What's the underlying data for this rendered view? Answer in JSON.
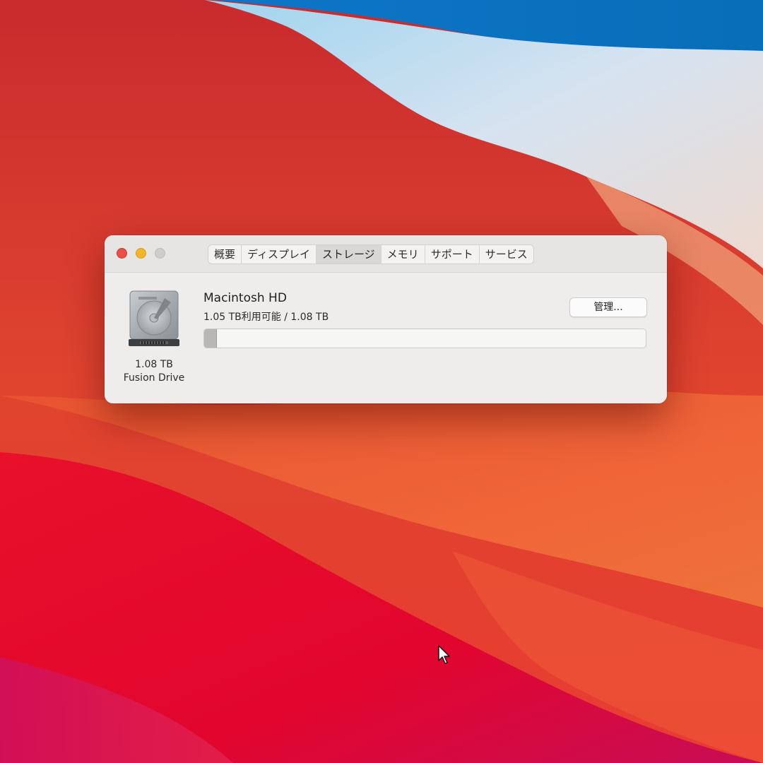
{
  "window": {
    "tabs": [
      {
        "label": "概要"
      },
      {
        "label": "ディスプレイ"
      },
      {
        "label": "ストレージ"
      },
      {
        "label": "メモリ"
      },
      {
        "label": "サポート"
      },
      {
        "label": "サービス"
      }
    ],
    "active_tab": "ストレージ"
  },
  "disk": {
    "icon": "hard-drive-icon",
    "size": "1.08 TB",
    "type": "Fusion Drive"
  },
  "volume": {
    "name": "Macintosh HD",
    "usage_text": "1.05 TB利用可能 / 1.08 TB",
    "used_fraction": 0.028
  },
  "manage_button": {
    "label": "管理..."
  },
  "colors": {
    "close": "#ec4f45",
    "minimize": "#f3b528",
    "zoom_disabled": "#cfcdcb"
  }
}
